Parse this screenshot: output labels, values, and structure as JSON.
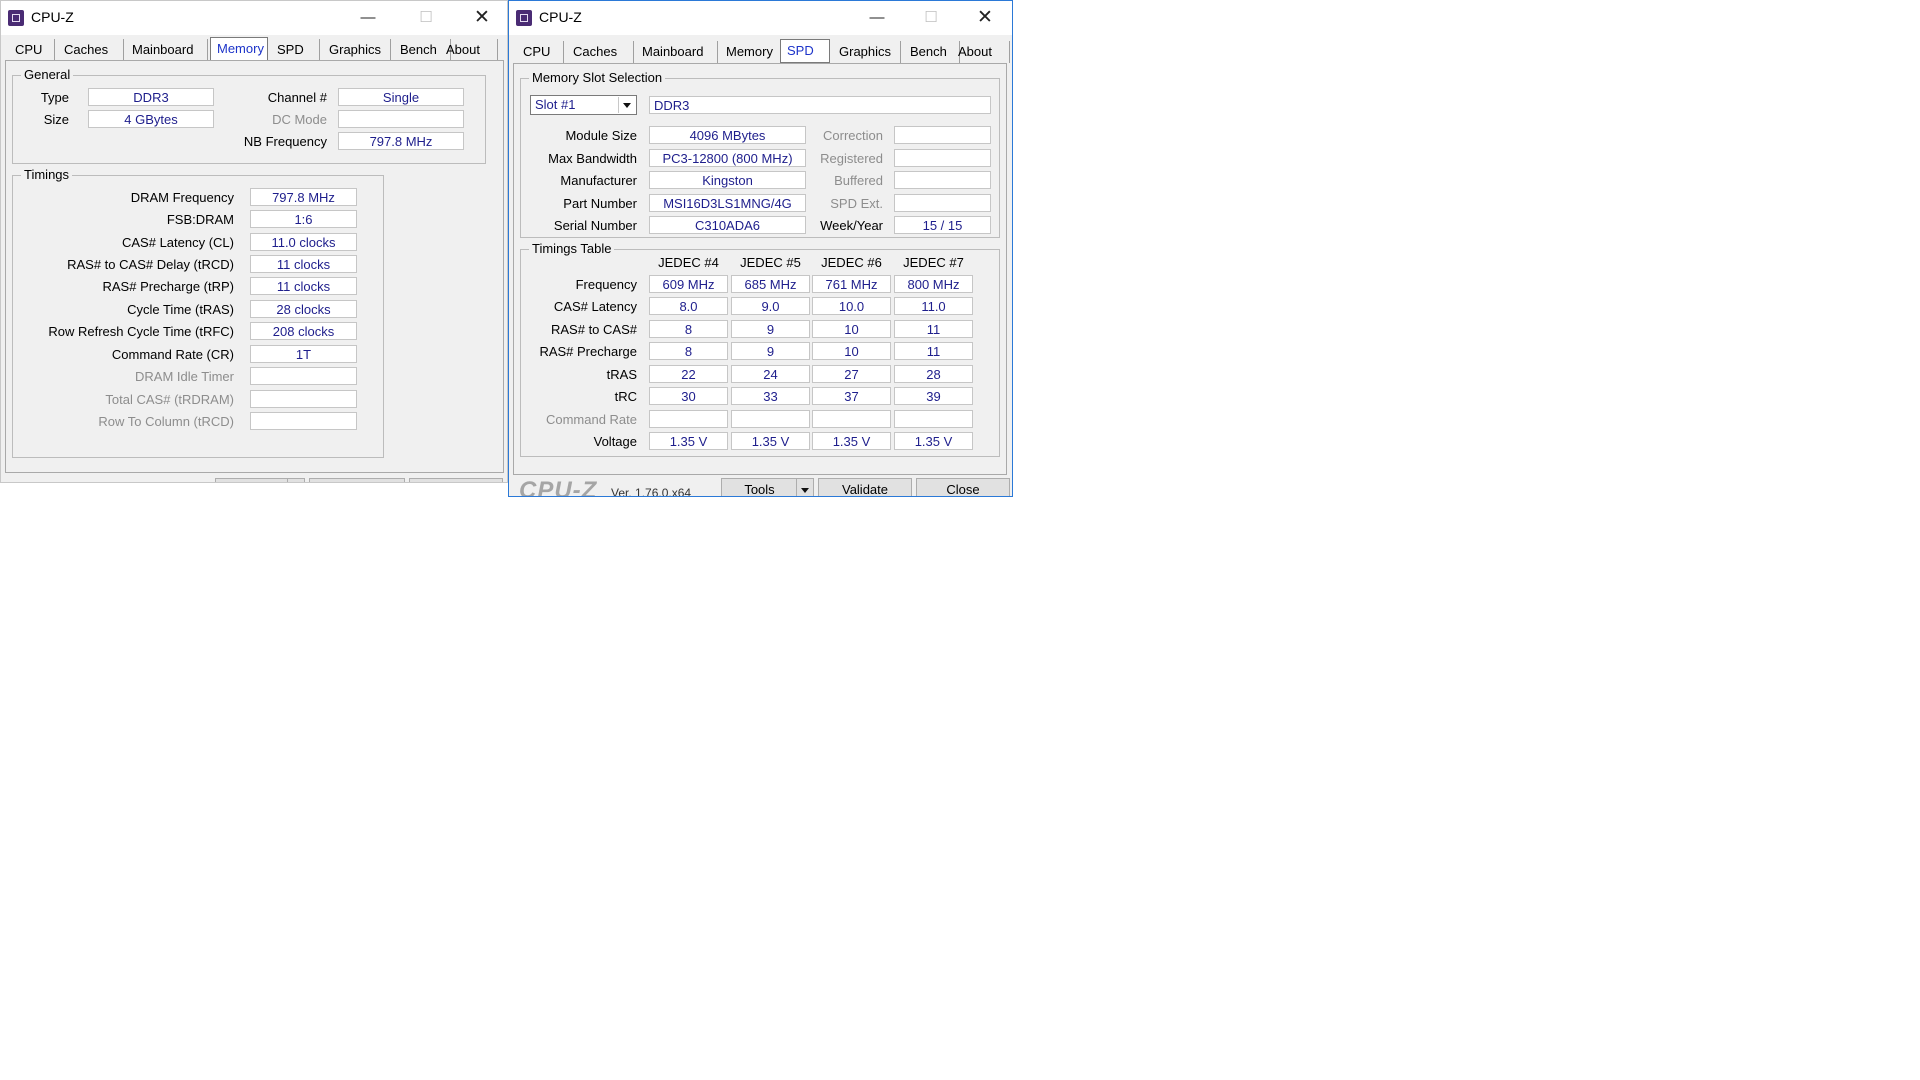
{
  "app_title": "CPU-Z",
  "tabs": [
    "CPU",
    "Caches",
    "Mainboard",
    "Memory",
    "SPD",
    "Graphics",
    "Bench",
    "About"
  ],
  "active_tab_left": "Memory",
  "active_tab_right": "SPD",
  "memory": {
    "general_title": "General",
    "type_label": "Type",
    "type_value": "DDR3",
    "size_label": "Size",
    "size_value": "4 GBytes",
    "channel_label": "Channel #",
    "channel_value": "Single",
    "dcmode_label": "DC Mode",
    "dcmode_value": "",
    "nbfreq_label": "NB Frequency",
    "nbfreq_value": "797.8 MHz",
    "timings_title": "Timings",
    "timings": [
      {
        "label": "DRAM Frequency",
        "value": "797.8 MHz",
        "enabled": true
      },
      {
        "label": "FSB:DRAM",
        "value": "1:6",
        "enabled": true
      },
      {
        "label": "CAS# Latency (CL)",
        "value": "11.0 clocks",
        "enabled": true
      },
      {
        "label": "RAS# to CAS# Delay (tRCD)",
        "value": "11 clocks",
        "enabled": true
      },
      {
        "label": "RAS# Precharge (tRP)",
        "value": "11 clocks",
        "enabled": true
      },
      {
        "label": "Cycle Time (tRAS)",
        "value": "28 clocks",
        "enabled": true
      },
      {
        "label": "Row Refresh Cycle Time (tRFC)",
        "value": "208 clocks",
        "enabled": true
      },
      {
        "label": "Command Rate (CR)",
        "value": "1T",
        "enabled": true
      },
      {
        "label": "DRAM Idle Timer",
        "value": "",
        "enabled": false
      },
      {
        "label": "Total CAS# (tRDRAM)",
        "value": "",
        "enabled": false
      },
      {
        "label": "Row To Column (tRCD)",
        "value": "",
        "enabled": false
      }
    ]
  },
  "spd": {
    "slot_group_title": "Memory Slot Selection",
    "slot_selected": "Slot #1",
    "slot_type": "DDR3",
    "module_size_label": "Module Size",
    "module_size_value": "4096 MBytes",
    "max_bw_label": "Max Bandwidth",
    "max_bw_value": "PC3-12800 (800 MHz)",
    "manufacturer_label": "Manufacturer",
    "manufacturer_value": "Kingston",
    "part_number_label": "Part Number",
    "part_number_value": "MSI16D3LS1MNG/4G",
    "serial_number_label": "Serial Number",
    "serial_number_value": "C310ADA6",
    "correction_label": "Correction",
    "correction_value": "",
    "registered_label": "Registered",
    "registered_value": "",
    "buffered_label": "Buffered",
    "buffered_value": "",
    "spd_ext_label": "SPD Ext.",
    "spd_ext_value": "",
    "week_year_label": "Week/Year",
    "week_year_value": "15 / 15",
    "timings_table_title": "Timings Table",
    "columns": [
      "JEDEC #4",
      "JEDEC #5",
      "JEDEC #6",
      "JEDEC #7"
    ],
    "rows": [
      {
        "label": "Frequency",
        "enabled": true,
        "values": [
          "609 MHz",
          "685 MHz",
          "761 MHz",
          "800 MHz"
        ]
      },
      {
        "label": "CAS# Latency",
        "enabled": true,
        "values": [
          "8.0",
          "9.0",
          "10.0",
          "11.0"
        ]
      },
      {
        "label": "RAS# to CAS#",
        "enabled": true,
        "values": [
          "8",
          "9",
          "10",
          "11"
        ]
      },
      {
        "label": "RAS# Precharge",
        "enabled": true,
        "values": [
          "8",
          "9",
          "10",
          "11"
        ]
      },
      {
        "label": "tRAS",
        "enabled": true,
        "values": [
          "22",
          "24",
          "27",
          "28"
        ]
      },
      {
        "label": "tRC",
        "enabled": true,
        "values": [
          "30",
          "33",
          "37",
          "39"
        ]
      },
      {
        "label": "Command Rate",
        "enabled": false,
        "values": [
          "",
          "",
          "",
          ""
        ]
      },
      {
        "label": "Voltage",
        "enabled": true,
        "values": [
          "1.35 V",
          "1.35 V",
          "1.35 V",
          "1.35 V"
        ]
      }
    ]
  },
  "footer": {
    "logo": "CPU-Z",
    "version": "Ver. 1.76.0.x64",
    "tools_label": "Tools",
    "validate_label": "Validate",
    "close_label": "Close"
  },
  "colors": {
    "value_text": "#1e1e8c",
    "active_tab_text": "#1d34c9",
    "disabled_label": "#8d8d8d",
    "icon_bg": "#4a2b74"
  }
}
